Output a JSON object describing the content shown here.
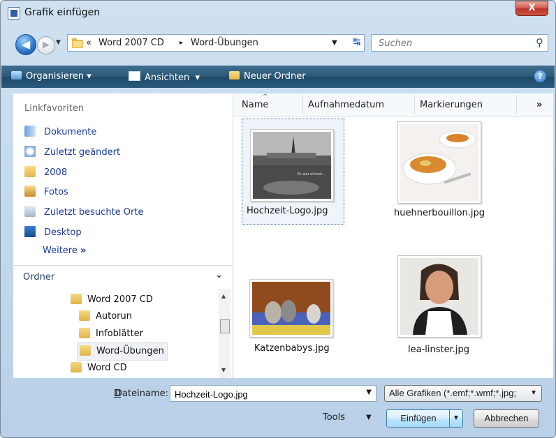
{
  "window": {
    "title": "Grafik einfügen",
    "close_label": "X"
  },
  "nav": {
    "breadcrumb": [
      "«",
      "Word 2007 CD",
      "▸",
      "Word-Übungen"
    ],
    "search_placeholder": "Suchen"
  },
  "toolbar": {
    "organize": "Organisieren",
    "views": "Ansichten",
    "new_folder": "Neuer Ordner"
  },
  "favorites": {
    "header": "Linkfavoriten",
    "items": [
      {
        "label": "Dokumente",
        "icon": "documents-icon"
      },
      {
        "label": "Zuletzt geändert",
        "icon": "recent-changed-icon"
      },
      {
        "label": "2008",
        "icon": "folder-icon"
      },
      {
        "label": "Fotos",
        "icon": "photos-icon"
      },
      {
        "label": "Zuletzt besuchte Orte",
        "icon": "recent-places-icon"
      },
      {
        "label": "Desktop",
        "icon": "desktop-icon"
      }
    ],
    "more": "Weitere"
  },
  "folders": {
    "header": "Ordner",
    "items": [
      {
        "label": "Word 2007 CD",
        "level": 0
      },
      {
        "label": "Autorun",
        "level": 1
      },
      {
        "label": "Infoblätter",
        "level": 1
      },
      {
        "label": "Word-Übungen",
        "level": 1,
        "selected": true
      },
      {
        "label": "Word CD",
        "level": 0
      }
    ]
  },
  "columns": [
    "Name",
    "Aufnahmedatum",
    "Markierungen",
    "»"
  ],
  "files": [
    {
      "name": "Hochzeit-Logo.jpg",
      "selected": true
    },
    {
      "name": "huehnerbouillon.jpg"
    },
    {
      "name": "Katzenbabys.jpg"
    },
    {
      "name": "lea-linster.jpg"
    }
  ],
  "footer": {
    "filename_label": "Dateiname:",
    "filename_value": "Hochzeit-Logo.jpg",
    "filter": "Alle Grafiken (*.emf;*.wmf;*.jpg;",
    "tools": "Tools",
    "insert": "Einfügen",
    "cancel": "Abbrechen"
  },
  "colors": {
    "toolbar": "#2c5878",
    "link": "#1a3c9c",
    "accent": "#2a6dc8"
  }
}
